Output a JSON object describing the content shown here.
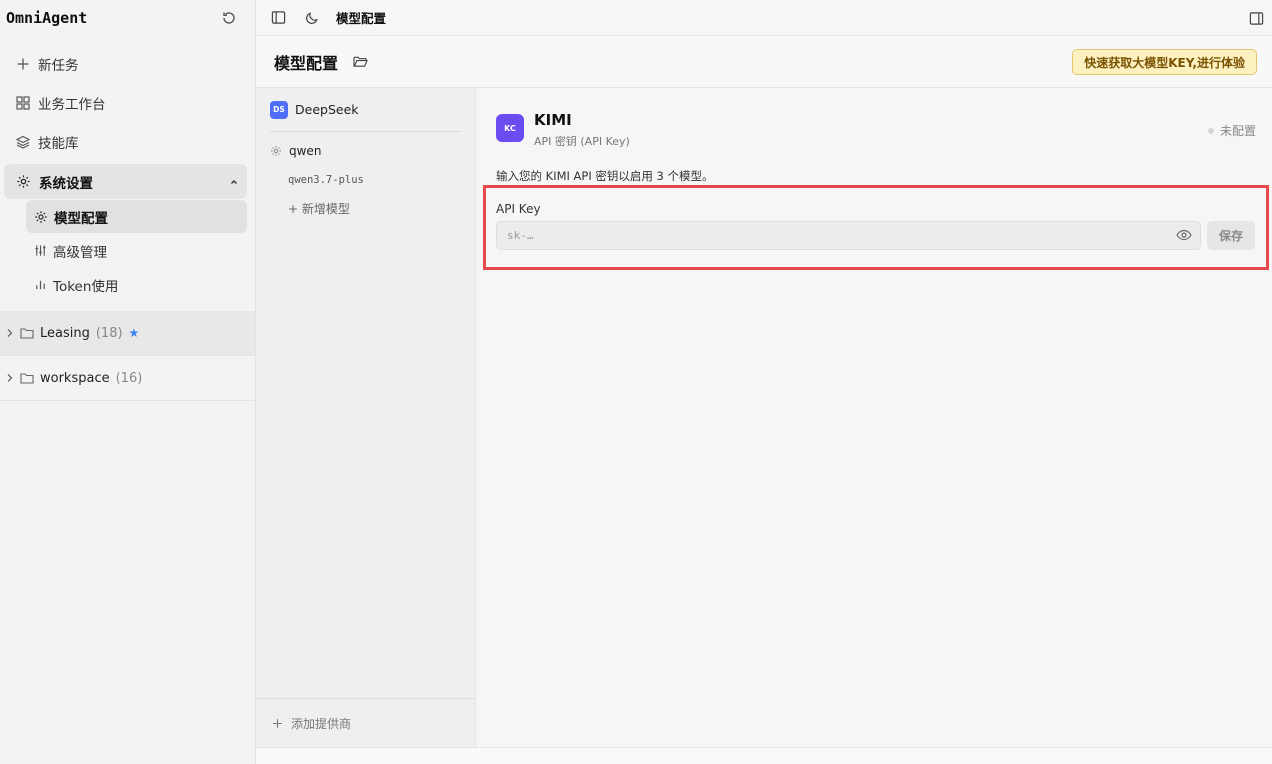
{
  "sidebar": {
    "brand": "OmniAgent",
    "nav": [
      {
        "label": "新任务",
        "icon": "plus-icon"
      },
      {
        "label": "业务工作台",
        "icon": "grid-icon"
      },
      {
        "label": "技能库",
        "icon": "layers-icon"
      }
    ],
    "settings_group": {
      "label": "系统设置",
      "items": [
        {
          "label": "模型配置",
          "active": true
        },
        {
          "label": "高级管理"
        },
        {
          "label": "Token使用"
        }
      ]
    },
    "folders": [
      {
        "name": "Leasing",
        "count": "(18)",
        "star": "★"
      },
      {
        "name": "workspace",
        "count": "(16)"
      }
    ]
  },
  "topbar": {
    "breadcrumb": "模型配置"
  },
  "page": {
    "title": "模型配置",
    "promo_label": "快速获取大模型KEY,进行体验"
  },
  "providers": {
    "list": [
      {
        "name": "DeepSeek",
        "badge": "DS"
      }
    ],
    "qwen": {
      "name": "qwen",
      "models": [
        "qwen3.7-plus"
      ],
      "add_model_label": "+ 新增模型"
    },
    "add_provider_label": "添加提供商"
  },
  "detail": {
    "logo": "KC",
    "name": "KIMI",
    "subtitle": "API 密钥 (API Key)",
    "status": "未配置",
    "description": "输入您的 KIMI API 密钥以启用 3 个模型。",
    "api_key_label": "API Key",
    "api_key_placeholder": "sk-…",
    "save_label": "保存"
  },
  "colors": {
    "highlight_border": "#e5484d",
    "promo_bg": "#fdf1c2",
    "deepseek_badge": "#4f6ef7",
    "kimi_logo": "#6a4cf0"
  }
}
